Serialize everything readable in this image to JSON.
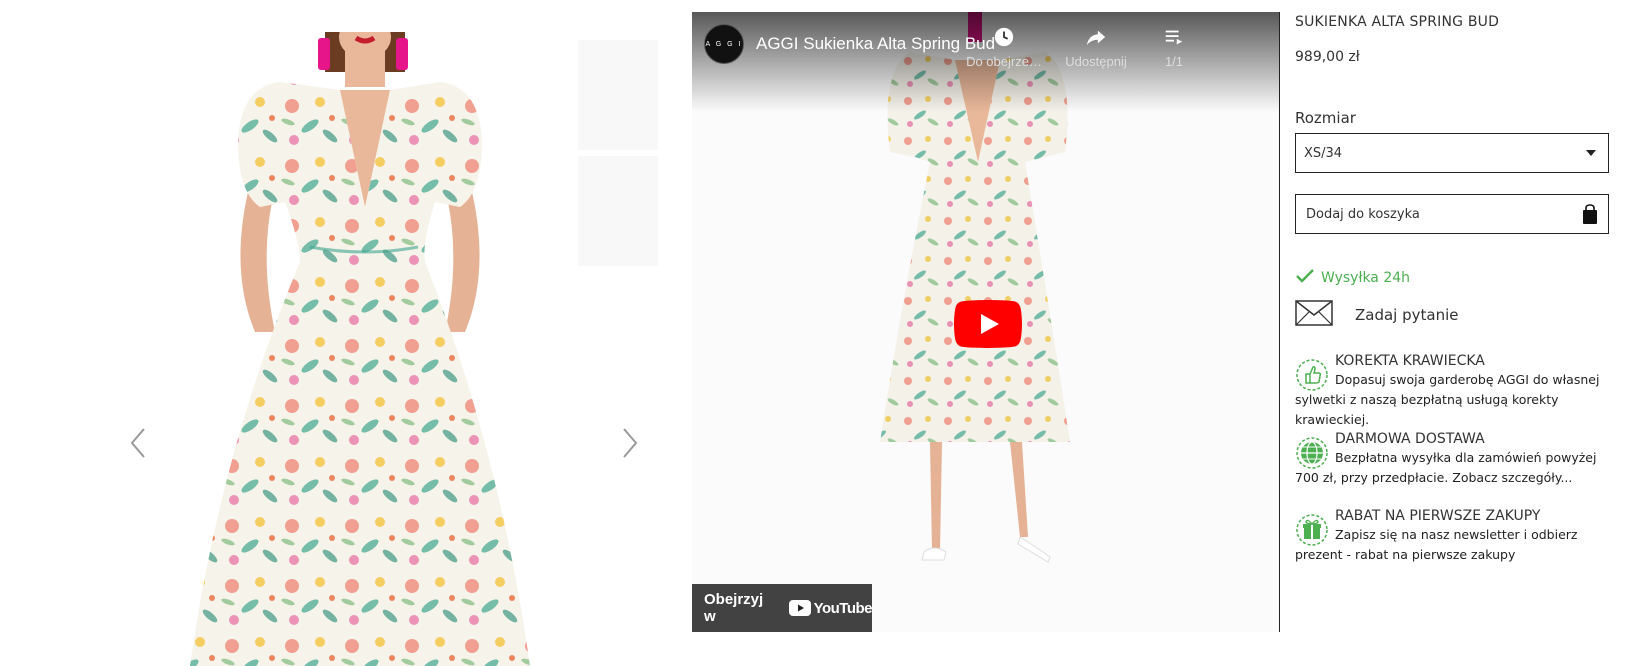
{
  "gallery": {
    "prev_icon": "chevron-left-icon",
    "next_icon": "chevron-right-icon",
    "thumbnail_count": 2
  },
  "video": {
    "channel_logo_text": "A G G I",
    "title": "AGGI Sukienka Alta Spring Bud",
    "actions": [
      {
        "label": "Do obejrze…",
        "icon": "clock-icon"
      },
      {
        "label": "Udostępnij",
        "icon": "share-icon"
      },
      {
        "label": "1/1",
        "icon": "playlist-icon"
      }
    ],
    "watch_on_label": "Obejrzyj w",
    "watch_on_brand": "YouTube",
    "play_color": "#ff0000"
  },
  "product": {
    "title": "SUKIENKA ALTA SPRING BUD",
    "price": "989,00 zł",
    "size_label": "Rozmiar",
    "size_selected": "XS/34",
    "add_to_cart": "Dodaj do koszyka",
    "shipping": "Wysyłka 24h",
    "shipping_color": "#4caf50",
    "ask_question": "Zadaj pytanie"
  },
  "benefits": [
    {
      "icon": "thumbs-up-icon",
      "heading": "KOREKTA KRAWIECKA",
      "text": "Dopasuj swoja garderobę AGGI do własnej sylwetki z naszą bezpłatną usługą korekty krawieckiej."
    },
    {
      "icon": "globe-icon",
      "heading": "DARMOWA DOSTAWA",
      "text": "Bezpłatna wysyłka dla zamówień powyżej 700 zł, przy przedpłacie. Zobacz szczegóły..."
    },
    {
      "icon": "gift-icon",
      "heading": "RABAT NA PIERWSZE ZAKUPY",
      "text": "Zapisz się na nasz newsletter i odbierz prezent - rabat na pierwsze zakupy"
    }
  ]
}
